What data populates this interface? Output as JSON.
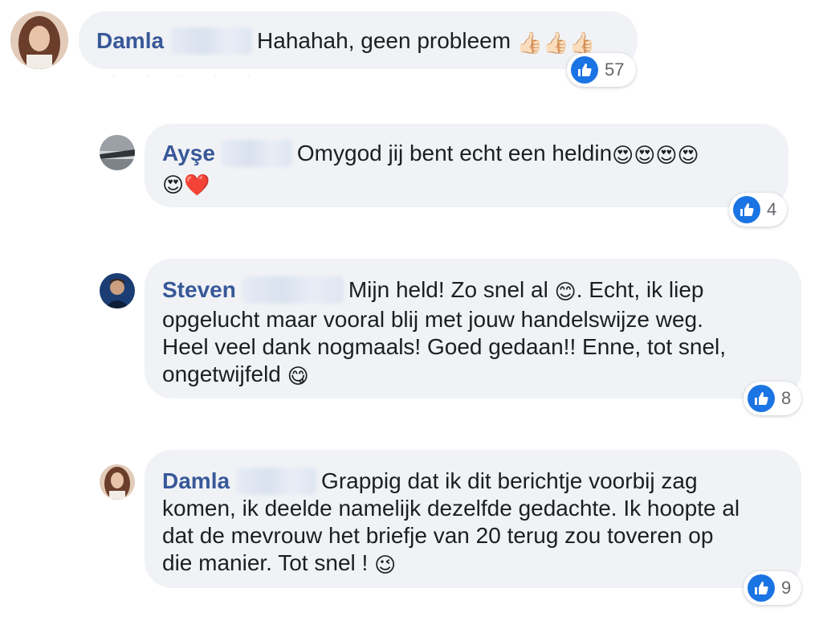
{
  "comments": [
    {
      "author": "Damla",
      "text": "Hahahah, geen probleem",
      "emojis": "👍🏻👍🏻👍🏻",
      "likes": "57",
      "avatar_colors": [
        "#7a4a35",
        "#d9b8a0"
      ]
    },
    {
      "author": "Ayşe",
      "text": "Omygod jij bent echt een heldin",
      "emojis": "😍😍😍😍",
      "emojis_line2": "😍❤️",
      "likes": "4",
      "avatar_colors": [
        "#555b60",
        "#c8ccd0"
      ]
    },
    {
      "author": "Steven",
      "text_line1": "Mijn held! Zo snel al",
      "emoji1": "😊",
      "text_line1b": ". Echt, ik liep",
      "text_line2": "opgelucht maar vooral blij met jouw handelswijze weg.",
      "text_line3": "Heel veel dank nogmaals! Goed gedaan!! Enne, tot snel,",
      "text_line4": "ongetwijfeld",
      "emoji2": "😋",
      "likes": "8",
      "avatar_colors": [
        "#1d3a6e",
        "#c9a07e"
      ]
    },
    {
      "author": "Damla",
      "text_line1": "Grappig dat ik dit berichtje voorbij zag",
      "text_line2": "komen, ik deelde namelijk dezelfde gedachte. Ik hoopte al",
      "text_line3": "dat de mevrouw het briefje van 20 terug zou toveren op",
      "text_line4": "die manier. Tot snel !",
      "emoji": "😉",
      "likes": "9",
      "avatar_colors": [
        "#7a4a35",
        "#d9b8a0"
      ]
    }
  ]
}
